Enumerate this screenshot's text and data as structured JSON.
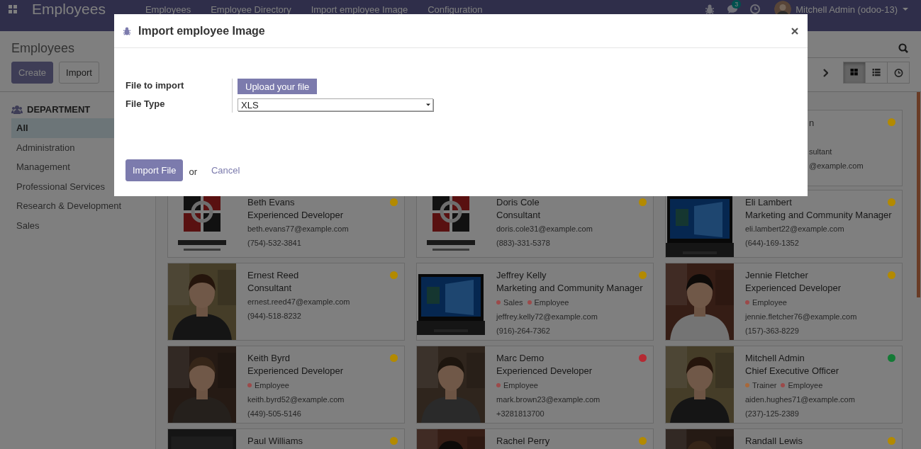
{
  "navbar": {
    "app_name": "Employees",
    "menu": [
      "Employees",
      "Employee Directory",
      "Import employee Image",
      "Configuration"
    ],
    "message_count": "3",
    "user": "Mitchell Admin (odoo-13)"
  },
  "control_panel": {
    "breadcrumb": "Employees",
    "buttons": [
      {
        "label": "Create",
        "kind": "primary"
      },
      {
        "label": "Import",
        "kind": "secondary"
      }
    ],
    "views": [
      {
        "kind": "kanban",
        "selected": true
      },
      {
        "kind": "list",
        "selected": false
      },
      {
        "kind": "activity",
        "selected": false
      }
    ]
  },
  "sidebar": {
    "header": "DEPARTMENT",
    "items": [
      {
        "label": "All",
        "selected": true
      },
      {
        "label": "Administration",
        "selected": false
      },
      {
        "label": "Management",
        "selected": false
      },
      {
        "label": "Professional Services",
        "selected": false
      },
      {
        "label": "Research & Development",
        "selected": false
      },
      {
        "label": "Sales",
        "selected": false
      }
    ]
  },
  "cards": [
    {
      "kind": "clipped",
      "lines": [
        "n",
        "sultant",
        "@example.com"
      ],
      "color": "#b38a00"
    },
    {
      "kind": "employee",
      "name": "Beth Evans",
      "job": "Experienced Developer",
      "email": "beth.evans77@example.com",
      "phone": "(754)-532-3841",
      "color": "#b38a00"
    },
    {
      "kind": "employee",
      "name": "Doris Cole",
      "job": "Consultant",
      "email": "doris.cole31@example.com",
      "phone": "(883)-331-5378",
      "color": "#b38a00"
    },
    {
      "kind": "employee",
      "name": "Eli Lambert",
      "job": "Marketing and Community Manager",
      "email": "eli.lambert22@example.com",
      "phone": "(644)-169-1352",
      "color": "#b38a00"
    },
    {
      "kind": "employee",
      "name": "Ernest Reed",
      "job": "Consultant",
      "email": "ernest.reed47@example.com",
      "phone": "(944)-518-8232",
      "color": "#b38a00"
    },
    {
      "kind": "employee",
      "name": "Jeffrey Kelly",
      "job": "Marketing and Community Manager",
      "tags": [
        {
          "label": "Sales",
          "color": "#9c4a4a"
        },
        {
          "label": "Employee",
          "color": "#9c4a4a"
        }
      ],
      "email": "jeffrey.kelly72@example.com",
      "phone": "(916)-264-7362",
      "color": "#b38a00"
    },
    {
      "kind": "employee",
      "name": "Jennie Fletcher",
      "job": "Experienced Developer",
      "tags": [
        {
          "label": "Employee",
          "color": "#9c4a4a"
        }
      ],
      "email": "jennie.fletcher76@example.com",
      "phone": "(157)-363-8229",
      "color": "#b38a00"
    },
    {
      "kind": "employee",
      "name": "Keith Byrd",
      "job": "Experienced Developer",
      "tags": [
        {
          "label": "Employee",
          "color": "#9c4a4a"
        }
      ],
      "email": "keith.byrd52@example.com",
      "phone": "(449)-505-5146",
      "color": "#b38a00"
    },
    {
      "kind": "employee",
      "name": "Marc Demo",
      "job": "Experienced Developer",
      "tags": [
        {
          "label": "Employee",
          "color": "#9c4a4a"
        }
      ],
      "email": "mark.brown23@example.com",
      "phone": "+3281813700",
      "color": "#b52a33"
    },
    {
      "kind": "employee",
      "name": "Mitchell Admin",
      "job": "Chief Executive Officer",
      "tags": [
        {
          "label": "Trainer",
          "color": "#a8683a"
        },
        {
          "label": "Employee",
          "color": "#9c4a4a"
        }
      ],
      "email": "aiden.hughes71@example.com",
      "phone": "(237)-125-2389",
      "color": "#137a35"
    },
    {
      "kind": "employee",
      "name": "Paul Williams",
      "color": "#b38a00"
    },
    {
      "kind": "employee",
      "name": "Rachel Perry",
      "color": "#b38a00"
    },
    {
      "kind": "employee",
      "name": "Randall Lewis",
      "color": "#b38a00"
    }
  ],
  "dialog": {
    "title": "Import employee Image",
    "fields": [
      {
        "kind": "upload",
        "label": "File to import",
        "button": "Upload your file"
      },
      {
        "kind": "select",
        "label": "File Type",
        "value": "XLS"
      }
    ],
    "primary_button": "Import File",
    "separator": "or",
    "cancel": "Cancel"
  }
}
